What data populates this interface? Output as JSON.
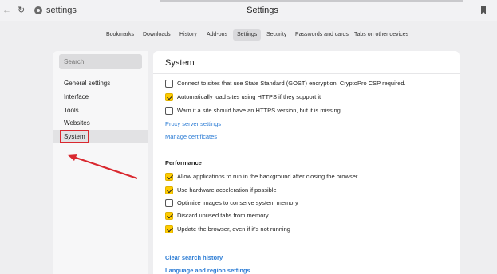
{
  "browser": {
    "address": "settings",
    "window_title": "Settings"
  },
  "tabs": [
    {
      "label": "Bookmarks"
    },
    {
      "label": "Downloads"
    },
    {
      "label": "History"
    },
    {
      "label": "Add-ons"
    },
    {
      "label": "Settings",
      "active": true
    },
    {
      "label": "Security"
    },
    {
      "label": "Passwords and cards"
    },
    {
      "label": "Tabs on other devices"
    }
  ],
  "sidebar": {
    "search_placeholder": "Search",
    "items": [
      {
        "label": "General settings"
      },
      {
        "label": "Interface"
      },
      {
        "label": "Tools"
      },
      {
        "label": "Websites"
      },
      {
        "label": "System",
        "selected": true
      }
    ]
  },
  "main": {
    "title": "System",
    "options": [
      {
        "label": "Connect to sites that use State Standard (GOST) encryption. CryptoPro CSP required.",
        "checked": false
      },
      {
        "label": "Automatically load sites using HTTPS if they support it",
        "checked": true
      },
      {
        "label": "Warn if a site should have an HTTPS version, but it is missing",
        "checked": false
      }
    ],
    "links": {
      "proxy": "Proxy server settings",
      "certificates": "Manage certificates"
    },
    "performance": {
      "title": "Performance",
      "options": [
        {
          "label": "Allow applications to run in the background after closing the browser",
          "checked": true
        },
        {
          "label": "Use hardware acceleration if possible",
          "checked": true
        },
        {
          "label": "Optimize images to conserve system memory",
          "checked": false
        },
        {
          "label": "Discard unused tabs from memory",
          "checked": true
        },
        {
          "label": "Update the browser, even if it's not running",
          "checked": true
        }
      ]
    },
    "bottom_links": {
      "clear_search": "Clear search history",
      "language": "Language and region settings"
    }
  },
  "colors": {
    "checkbox_checked": "#ffcc00",
    "link": "#2a7bd4",
    "highlight": "#d9282f"
  }
}
